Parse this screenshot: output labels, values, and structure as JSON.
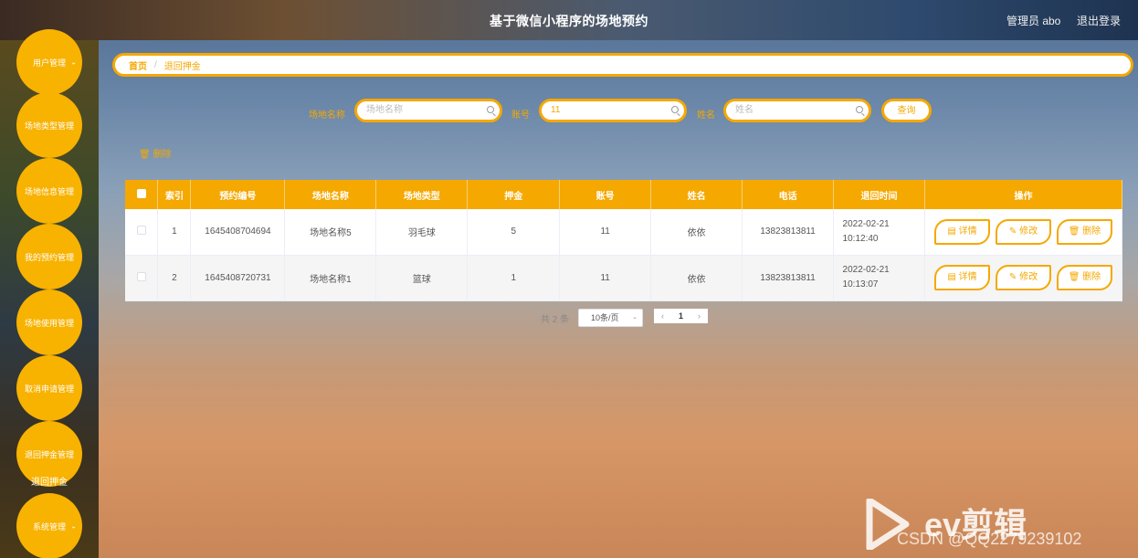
{
  "header": {
    "title": "基于微信小程序的场地预约",
    "user": "管理员 abo",
    "logout": "退出登录"
  },
  "sidebar": {
    "items": [
      {
        "label": "用户管理",
        "chevron": true
      },
      {
        "label": "场地类型管理"
      },
      {
        "label": "场地信息管理"
      },
      {
        "label": "我的预约管理"
      },
      {
        "label": "场地使用管理"
      },
      {
        "label": "取消申请管理"
      },
      {
        "label": "退回押金管理"
      },
      {
        "label": "系统管理",
        "chevron": true
      }
    ],
    "sub_item": "退回押金"
  },
  "breadcrumb": {
    "home": "首页",
    "separator": "/",
    "current": "退回押金"
  },
  "search": {
    "venue_label": "场地名称",
    "venue_placeholder": "场地名称",
    "account_label": "账号",
    "account_value": "11",
    "name_label": "姓名",
    "name_placeholder": "姓名",
    "query_button": "查询"
  },
  "toolbar": {
    "delete_label": "删除"
  },
  "table": {
    "headers": [
      "索引",
      "预约编号",
      "场地名称",
      "场地类型",
      "押金",
      "账号",
      "姓名",
      "电话",
      "退回时间",
      "操作"
    ],
    "rows": [
      {
        "index": "1",
        "booking_no": "1645408704694",
        "venue": "场地名称5",
        "type": "羽毛球",
        "deposit": "5",
        "account": "11",
        "name": "依依",
        "phone": "13823813811",
        "time": "2022-02-21 10:12:40"
      },
      {
        "index": "2",
        "booking_no": "1645408720731",
        "venue": "场地名称1",
        "type": "篮球",
        "deposit": "1",
        "account": "11",
        "name": "依依",
        "phone": "13823813811",
        "time": "2022-02-21 10:13:07"
      }
    ],
    "actions": {
      "detail": "详情",
      "edit": "修改",
      "delete": "删除"
    }
  },
  "pagination": {
    "total": "共 2 条",
    "page_size": "10条/页",
    "current_page": "1",
    "prev": "‹",
    "next": "›"
  },
  "watermark": {
    "brand": "ev剪辑",
    "csdn": "CSDN @QQ2279239102"
  },
  "colors": {
    "accent": "#f5a800",
    "menu": "#f8b200"
  }
}
